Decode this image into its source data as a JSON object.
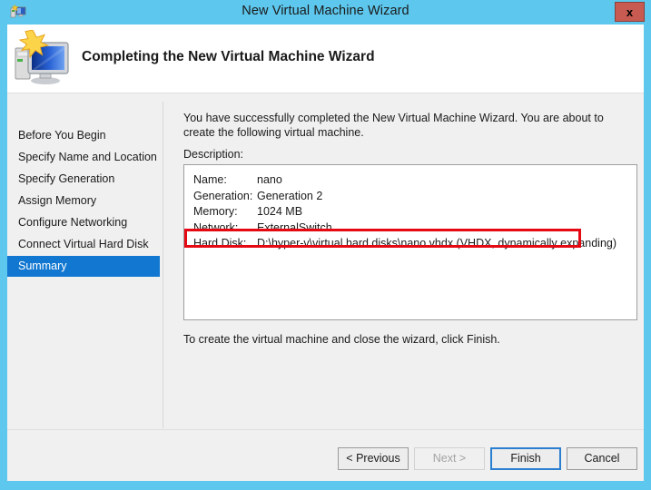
{
  "window": {
    "title": "New Virtual Machine Wizard",
    "title_icon": "vm-wizard-monitor-icon",
    "close_label": "x",
    "titlebar_color": "#5dc7ed",
    "close_button_color": "#c75b52"
  },
  "header": {
    "icon": "computer-monitor-star-icon",
    "title": "Completing the New Virtual Machine Wizard"
  },
  "sidebar": {
    "items": [
      {
        "label": "Before You Begin",
        "selected": false
      },
      {
        "label": "Specify Name and Location",
        "selected": false
      },
      {
        "label": "Specify Generation",
        "selected": false
      },
      {
        "label": "Assign Memory",
        "selected": false
      },
      {
        "label": "Configure Networking",
        "selected": false
      },
      {
        "label": "Connect Virtual Hard Disk",
        "selected": false
      },
      {
        "label": "Summary",
        "selected": true
      }
    ],
    "selected_color": "#1177d1"
  },
  "main": {
    "intro_text": "You have successfully completed the New Virtual Machine Wizard. You are about to create the following virtual machine.",
    "description_label": "Description:",
    "details": [
      {
        "label": "Name:",
        "value": "nano",
        "highlighted": false
      },
      {
        "label": "Generation:",
        "value": "Generation 2",
        "highlighted": false
      },
      {
        "label": "Memory:",
        "value": "1024 MB",
        "highlighted": false
      },
      {
        "label": "Network:",
        "value": "ExternalSwitch",
        "highlighted": false
      },
      {
        "label": "Hard Disk:",
        "value": "D:\\hyper-v\\virtual hard disks\\nano.vhdx (VHDX, dynamically expanding)",
        "highlighted": true
      }
    ],
    "highlight_color": "#e50914",
    "finish_hint": "To create the virtual machine and close the wizard, click Finish."
  },
  "footer": {
    "buttons": [
      {
        "label": "< Previous",
        "state": "enabled"
      },
      {
        "label": "Next >",
        "state": "disabled"
      },
      {
        "label": "Finish",
        "state": "default"
      },
      {
        "label": "Cancel",
        "state": "enabled"
      }
    ]
  }
}
